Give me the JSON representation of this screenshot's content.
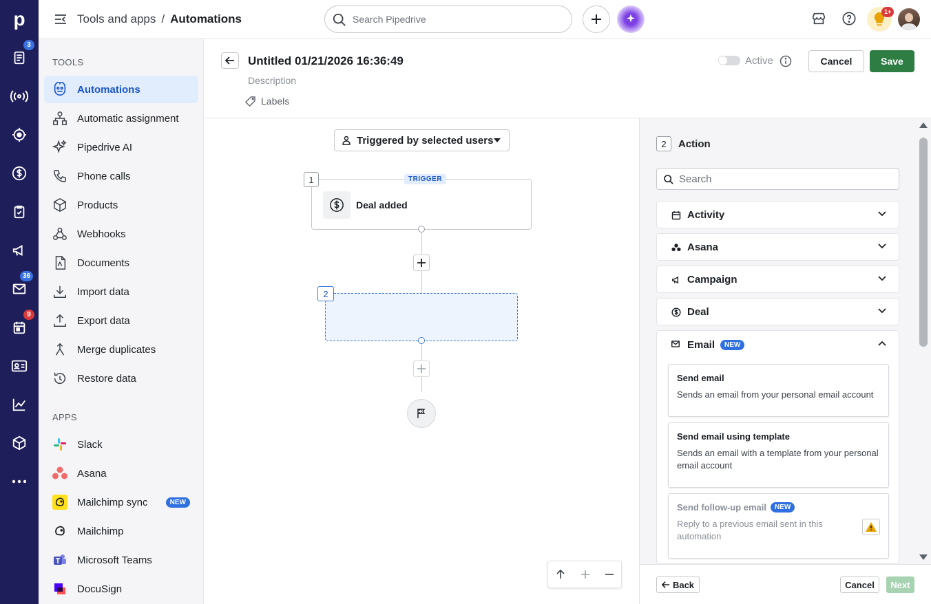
{
  "rail": {
    "logo": "p",
    "items": [
      {
        "icon": "leads-icon",
        "badge": "3"
      },
      {
        "icon": "broadcast-icon",
        "badge": ""
      },
      {
        "icon": "target-icon",
        "badge": ""
      },
      {
        "icon": "dollar-icon",
        "badge": ""
      },
      {
        "icon": "clipboard-icon",
        "badge": ""
      },
      {
        "icon": "megaphone-icon",
        "badge": ""
      },
      {
        "icon": "mail-icon",
        "badge": "36"
      },
      {
        "icon": "calendar-icon",
        "badge": "9"
      },
      {
        "icon": "contacts-icon",
        "badge": ""
      },
      {
        "icon": "chart-icon",
        "badge": ""
      },
      {
        "icon": "box-icon",
        "badge": ""
      },
      {
        "icon": "more-icon",
        "badge": ""
      }
    ]
  },
  "header": {
    "breadcrumb_parent": "Tools and apps",
    "breadcrumb_sep": "/",
    "breadcrumb_current": "Automations",
    "search_placeholder": "Search Pipedrive",
    "notif_badge": "1+"
  },
  "sidebar": {
    "tools_heading": "TOOLS",
    "tools": [
      {
        "label": "Automations",
        "icon": "automation-icon",
        "active": true
      },
      {
        "label": "Automatic assignment",
        "icon": "assignment-icon"
      },
      {
        "label": "Pipedrive AI",
        "icon": "sparkle-icon"
      },
      {
        "label": "Phone calls",
        "icon": "phone-icon"
      },
      {
        "label": "Products",
        "icon": "box-icon"
      },
      {
        "label": "Webhooks",
        "icon": "webhook-icon"
      },
      {
        "label": "Documents",
        "icon": "document-icon"
      },
      {
        "label": "Import data",
        "icon": "download-icon"
      },
      {
        "label": "Export data",
        "icon": "upload-icon"
      },
      {
        "label": "Merge duplicates",
        "icon": "merge-icon"
      },
      {
        "label": "Restore data",
        "icon": "restore-icon"
      }
    ],
    "apps_heading": "APPS",
    "apps": [
      {
        "label": "Slack",
        "icon": "slack-icon"
      },
      {
        "label": "Asana",
        "icon": "asana-icon"
      },
      {
        "label": "Mailchimp sync",
        "icon": "mailchimp-icon",
        "tag": "NEW"
      },
      {
        "label": "Mailchimp",
        "icon": "mailchimp-icon"
      },
      {
        "label": "Microsoft Teams",
        "icon": "teams-icon"
      },
      {
        "label": "DocuSign",
        "icon": "docusign-icon"
      }
    ]
  },
  "automation": {
    "title": "Untitled 01/21/2026 16:36:49",
    "description_placeholder": "Description",
    "labels": "Labels",
    "active_label": "Active",
    "cancel": "Cancel",
    "save": "Save"
  },
  "canvas": {
    "trigger_select": "Triggered by selected users",
    "node1_num": "1",
    "trigger_tag": "TRIGGER",
    "node1_label": "Deal added",
    "node2_num": "2"
  },
  "panel": {
    "step_num": "2",
    "title": "Action",
    "search_placeholder": "Search",
    "categories": [
      {
        "label": "Activity",
        "icon": "calendar-icon"
      },
      {
        "label": "Asana",
        "icon": "asana-icon"
      },
      {
        "label": "Campaign",
        "icon": "megaphone-icon"
      },
      {
        "label": "Deal",
        "icon": "dollar-icon"
      }
    ],
    "email": {
      "label": "Email",
      "tag": "NEW",
      "cards": [
        {
          "title": "Send email",
          "desc": "Sends an email from your personal email account"
        },
        {
          "title": "Send email using template",
          "desc": "Sends an email with a template from your personal email account"
        },
        {
          "title": "Send follow-up email",
          "tag": "NEW",
          "desc": "Reply to a previous email sent in this automation"
        }
      ]
    },
    "back": "Back",
    "cancel": "Cancel",
    "next": "Next"
  }
}
